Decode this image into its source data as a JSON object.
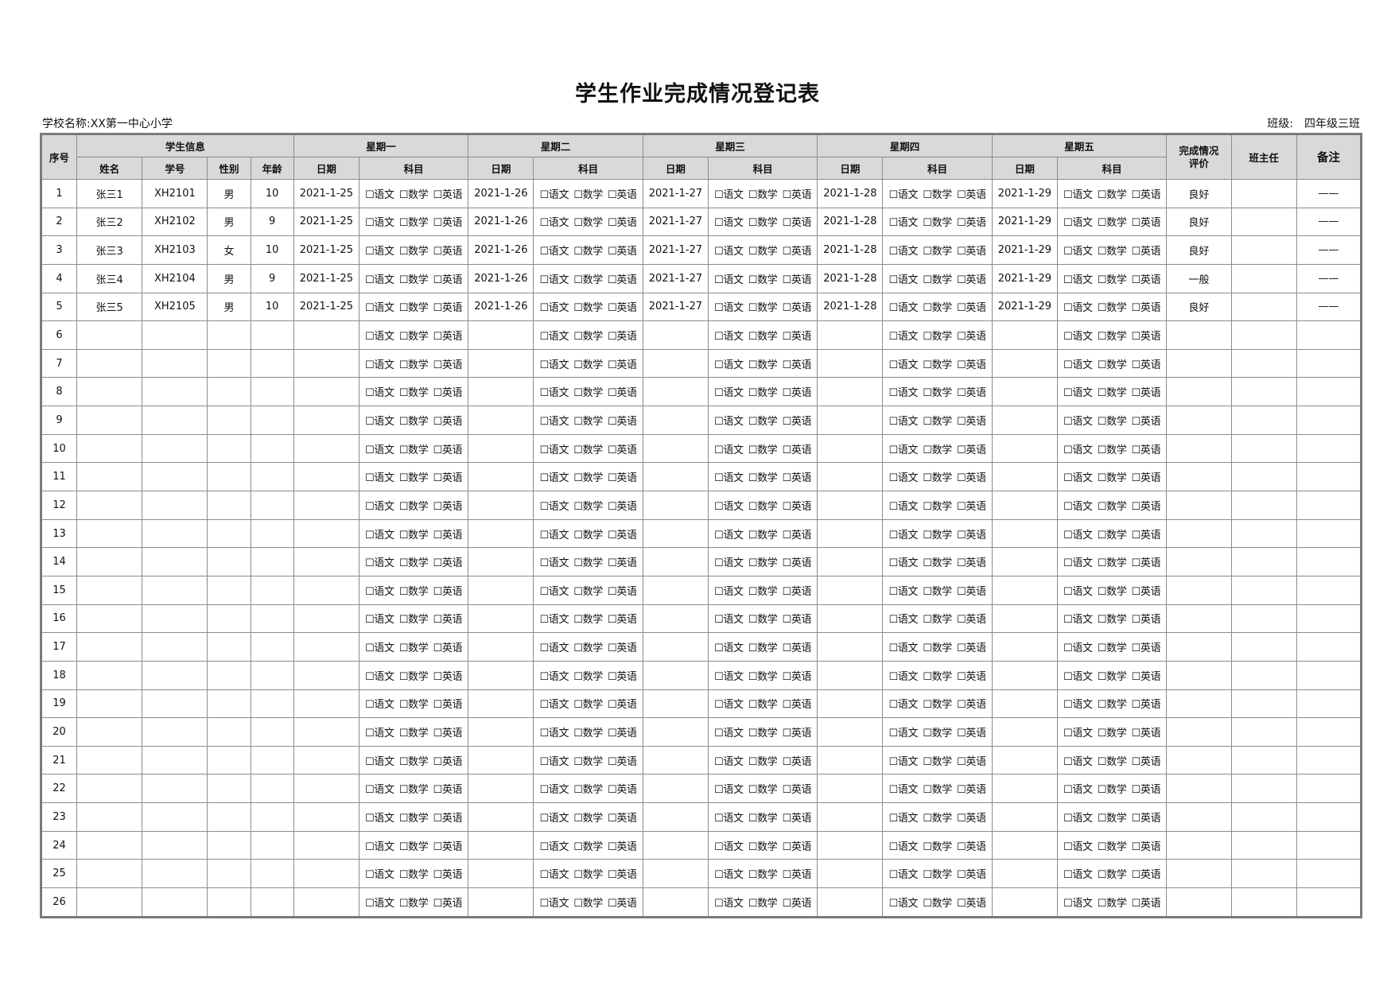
{
  "title": "学生作业完成情况登记表",
  "school": {
    "label": "学校名称:",
    "value": "XX第一中心小学"
  },
  "class": {
    "label": "班级:",
    "value": "四年级三班"
  },
  "header": {
    "seq": "序号",
    "student_info": "学生信息",
    "name": "姓名",
    "id": "学号",
    "gender": "性别",
    "age": "年龄",
    "days": [
      "星期一",
      "星期二",
      "星期三",
      "星期四",
      "星期五"
    ],
    "date": "日期",
    "subject": "科目",
    "eval_line1": "完成情况",
    "eval_line2": "评价",
    "teacher": "班主任",
    "remark": "备注"
  },
  "subjects": [
    "☐语文",
    "☐数学",
    "☐英语"
  ],
  "dates": [
    "2021-1-25",
    "2021-1-26",
    "2021-1-27",
    "2021-1-28",
    "2021-1-29"
  ],
  "rows": [
    {
      "seq": "1",
      "name": "张三1",
      "id": "XH2101",
      "gender": "男",
      "age": "10",
      "has_dates": true,
      "eval": "良好",
      "teacher": "",
      "remark": "——"
    },
    {
      "seq": "2",
      "name": "张三2",
      "id": "XH2102",
      "gender": "男",
      "age": "9",
      "has_dates": true,
      "eval": "良好",
      "teacher": "",
      "remark": "——"
    },
    {
      "seq": "3",
      "name": "张三3",
      "id": "XH2103",
      "gender": "女",
      "age": "10",
      "has_dates": true,
      "eval": "良好",
      "teacher": "",
      "remark": "——"
    },
    {
      "seq": "4",
      "name": "张三4",
      "id": "XH2104",
      "gender": "男",
      "age": "9",
      "has_dates": true,
      "eval": "一般",
      "teacher": "",
      "remark": "——"
    },
    {
      "seq": "5",
      "name": "张三5",
      "id": "XH2105",
      "gender": "男",
      "age": "10",
      "has_dates": true,
      "eval": "良好",
      "teacher": "",
      "remark": "——"
    },
    {
      "seq": "6"
    },
    {
      "seq": "7"
    },
    {
      "seq": "8"
    },
    {
      "seq": "9"
    },
    {
      "seq": "10"
    },
    {
      "seq": "11"
    },
    {
      "seq": "12"
    },
    {
      "seq": "13"
    },
    {
      "seq": "14"
    },
    {
      "seq": "15"
    },
    {
      "seq": "16"
    },
    {
      "seq": "17"
    },
    {
      "seq": "18"
    },
    {
      "seq": "19"
    },
    {
      "seq": "20"
    },
    {
      "seq": "21"
    },
    {
      "seq": "22"
    },
    {
      "seq": "23"
    },
    {
      "seq": "24"
    },
    {
      "seq": "25"
    },
    {
      "seq": "26"
    }
  ]
}
